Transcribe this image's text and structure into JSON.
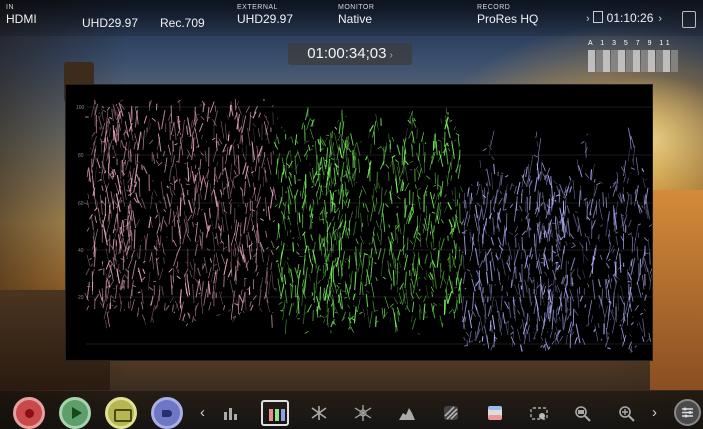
{
  "topbar": {
    "in_label": "IN",
    "in_value": "HDMI",
    "in_format": "UHD29.97",
    "in_colorspace": "Rec.709",
    "external_label": "EXTERNAL",
    "external_value": "UHD29.97",
    "monitor_label": "MONITOR",
    "monitor_value": "Native",
    "record_label": "RECORD",
    "record_value": "ProRes HQ",
    "remaining_time": "01:10:26"
  },
  "timecode": "01:00:34;03",
  "audio_meter": {
    "channel_labels": "A 1 3 5 7 9 11"
  },
  "waveform": {
    "type": "RGB parade",
    "channels": [
      "red",
      "green",
      "blue"
    ]
  },
  "transport": {
    "record_icon": "record-icon",
    "play_icon": "play-icon",
    "monitor_icon": "monitor-icon",
    "tag_icon": "tag-icon"
  },
  "toolbar_icons": [
    "waveform-luma-icon",
    "rgb-parade-icon",
    "vectorscope-icon",
    "focus-peaking-icon",
    "histogram-icon",
    "zebra-icon",
    "false-color-icon",
    "frame-guides-icon",
    "zoom-icon",
    "magnify-icon"
  ],
  "colors": {
    "record": "#c84a4a",
    "play": "#5e9e6a",
    "monitor": "#b6b653",
    "tag": "#6e77c4"
  }
}
